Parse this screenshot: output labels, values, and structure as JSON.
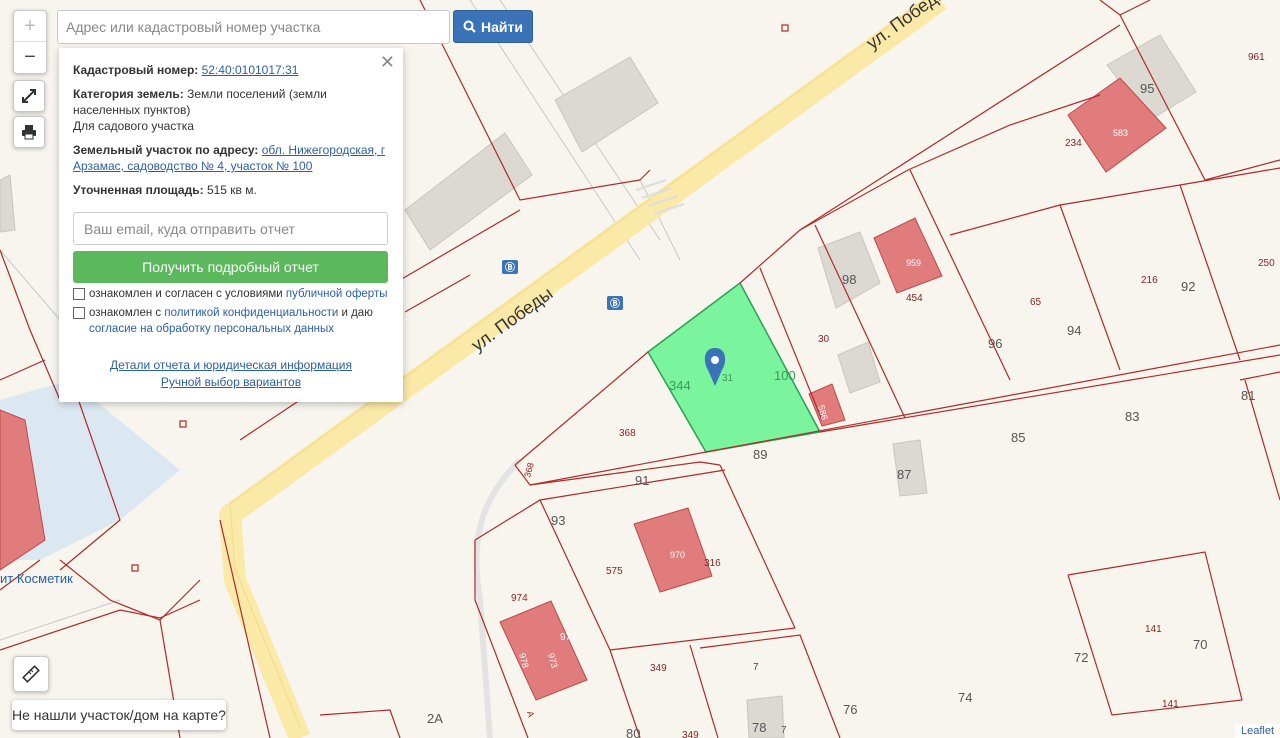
{
  "search": {
    "placeholder": "Адрес или кадастровый номер участка",
    "button_label": "Найти"
  },
  "controls": {
    "zoom_in": "+",
    "zoom_out": "−"
  },
  "popup": {
    "close": "✕",
    "cadastral_label": "Кадастровый номер:",
    "cadastral_value": "52:40:0101017:31",
    "category_label": "Категория земель:",
    "category_value": "Земли поселений (земли населенных пунктов)",
    "use_value": "Для садового участка",
    "address_label": "Земельный участок по адресу:",
    "address_value": "обл. Нижегородская, г Арзамас, садоводство № 4, участок № 100",
    "area_label": "Уточненная площадь:",
    "area_value": "515 кв м.",
    "email_placeholder": "Ваш email, куда отправить отчет",
    "report_button": "Получить подробный отчет",
    "check1_text": "ознакомлен и согласен с условиями ",
    "check1_link": "публичной оферты",
    "check2_text": "ознакомлен с ",
    "check2_link": "политикой конфиденциальности",
    "check2_text2": " и даю ",
    "check2_link2": "согласие на обработку персональных данных",
    "details_link": "Детали отчета и юридическая информация",
    "manual_link": "Ручной выбор вариантов"
  },
  "not_found_button": "Не нашли участок/дом на карте?",
  "attribution": "Leaflet",
  "map": {
    "street_label_1": "ул. Победы",
    "street_label_2": "ул. Победы",
    "poi_label": "ит Косметик",
    "colors": {
      "road": "#fbe9a8",
      "parcel_line": "#b02a2a",
      "selected_parcel": "#7af59e",
      "building_red": "#e07c7c",
      "building_gray": "#dcd9d3"
    },
    "labels": [
      "961",
      "95",
      "583",
      "234",
      "250",
      "959",
      "454",
      "98",
      "216",
      "92",
      "65",
      "94",
      "96",
      "30",
      "586",
      "100",
      "31",
      "344",
      "368",
      "368",
      "89",
      "83",
      "85",
      "81",
      "87",
      "91",
      "93",
      "970",
      "316",
      "575",
      "974",
      "974",
      "978",
      "973",
      "349",
      "7",
      "72",
      "141",
      "141",
      "70",
      "74",
      "76",
      "78",
      "7",
      "80",
      "349",
      "2А",
      "А"
    ]
  }
}
